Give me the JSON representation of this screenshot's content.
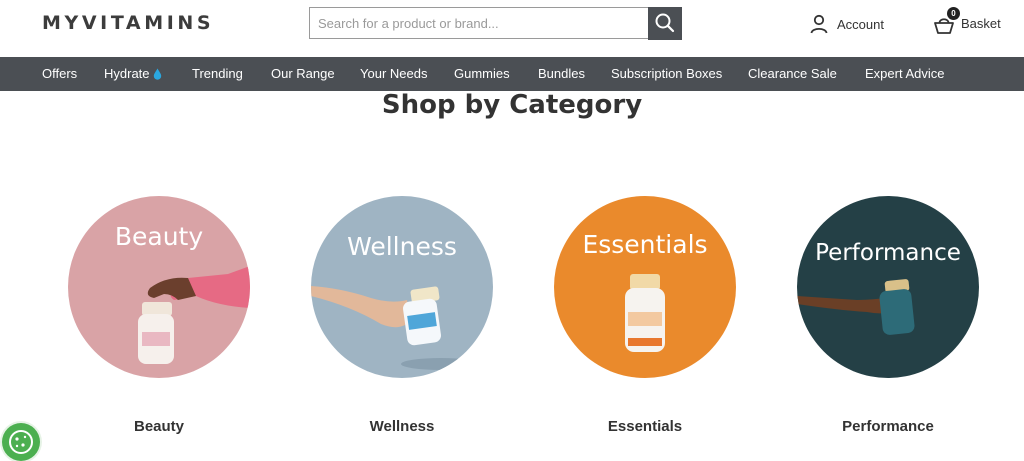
{
  "header": {
    "logo": "MYVITAMINS",
    "search": {
      "placeholder": "Search for a product or brand..."
    },
    "account_label": "Account",
    "basket_label": "Basket",
    "basket_count": "0"
  },
  "nav": {
    "items": [
      "Offers",
      "Hydrate",
      "Trending",
      "Our Range",
      "Your Needs",
      "Gummies",
      "Bundles",
      "Subscription Boxes",
      "Clearance Sale",
      "Expert Advice"
    ]
  },
  "main": {
    "title": "Shop by Category",
    "categories": [
      {
        "circle_label": "Beauty",
        "caption": "Beauty",
        "color": "#d9a3a6"
      },
      {
        "circle_label": "Wellness",
        "caption": "Wellness",
        "color": "#9fb4c3"
      },
      {
        "circle_label": "Essentials",
        "caption": "Essentials",
        "color": "#ea8a2c"
      },
      {
        "circle_label": "Performance",
        "caption": "Performance",
        "color": "#244046"
      }
    ]
  },
  "colors": {
    "nav_bg": "#4b4f54",
    "cookie": "#4caf50",
    "water_drop": "#2aa7df"
  }
}
